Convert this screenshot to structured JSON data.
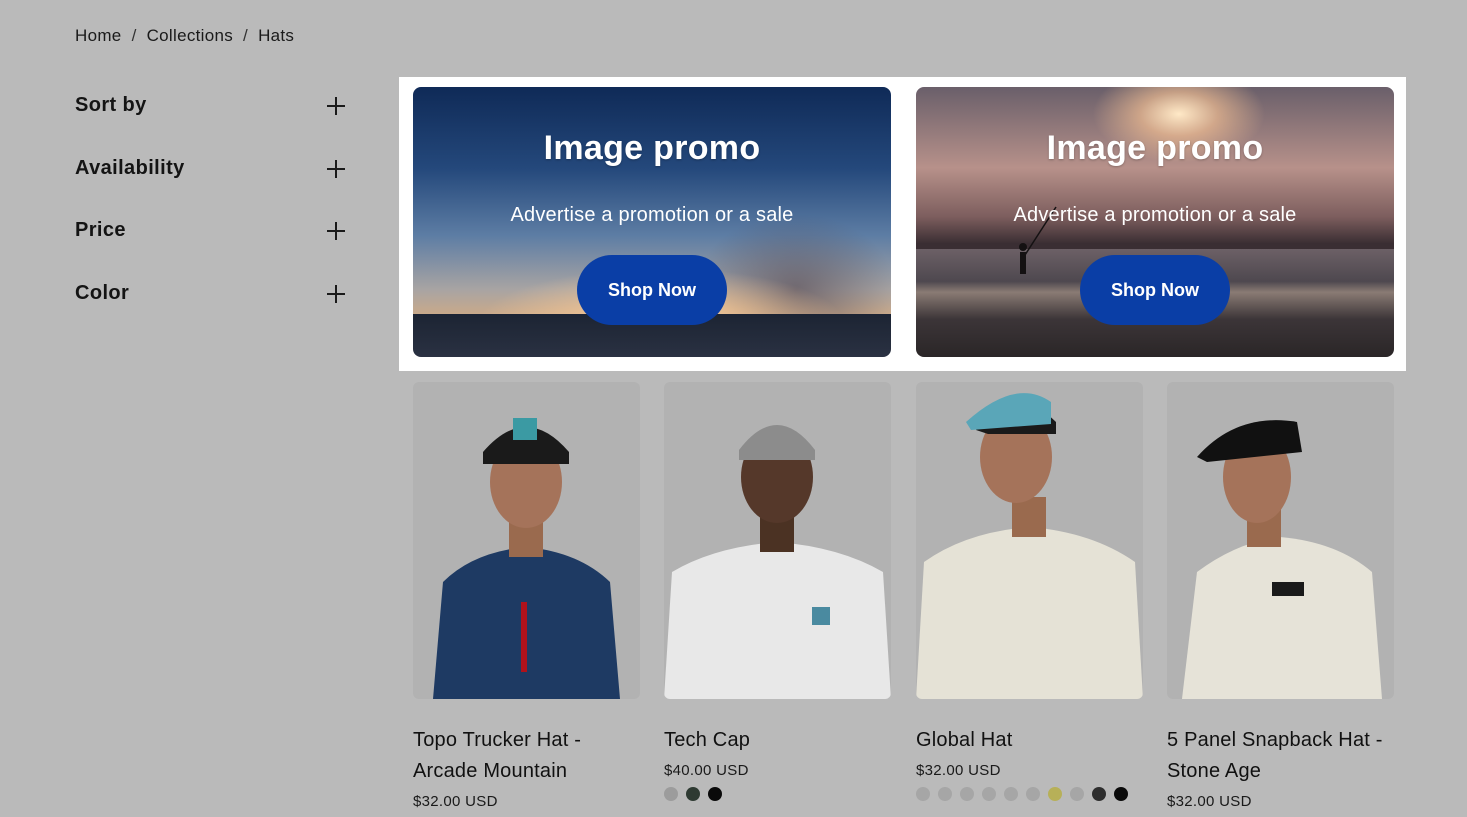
{
  "breadcrumb": {
    "home": "Home",
    "collections": "Collections",
    "current": "Hats",
    "separator": "/"
  },
  "filters": [
    {
      "label": "Sort by",
      "icon": "plus-icon"
    },
    {
      "label": "Availability",
      "icon": "plus-icon"
    },
    {
      "label": "Price",
      "icon": "plus-icon"
    },
    {
      "label": "Color",
      "icon": "plus-icon"
    }
  ],
  "promos": [
    {
      "title": "Image promo",
      "subtitle": "Advertise a promotion or a sale",
      "button": "Shop Now"
    },
    {
      "title": "Image promo",
      "subtitle": "Advertise a promotion or a sale",
      "button": "Shop Now"
    }
  ],
  "products": [
    {
      "title_line1": "Topo Trucker Hat -",
      "title_line2": "Arcade Mountain",
      "price": "$32.00 USD",
      "hat_color": "#1a1a1a",
      "shirt_color": "#1e3a63",
      "swatches": []
    },
    {
      "title_line1": "Tech Cap",
      "title_line2": "",
      "price": "$40.00 USD",
      "hat_color": "#8c8c8c",
      "shirt_color": "#e8e8e8",
      "swatches": [
        "#9c9c9c",
        "#2e3a32",
        "#0a0a0a"
      ]
    },
    {
      "title_line1": "Global Hat",
      "title_line2": "",
      "price": "$32.00 USD",
      "hat_color": "#5aa6b8",
      "shirt_color": "#e5e2d6",
      "swatches": [
        "#a6a6a6",
        "#a6a6a6",
        "#a6a6a6",
        "#a6a6a6",
        "#a6a6a6",
        "#a6a6a6",
        "#b7b058",
        "#a6a6a6",
        "#2e2e2e",
        "#0a0a0a"
      ]
    },
    {
      "title_line1": "5 Panel Snapback Hat -",
      "title_line2": "Stone Age",
      "price": "$32.00 USD",
      "hat_color": "#111111",
      "shirt_color": "#e6e3d8",
      "swatches": []
    }
  ],
  "colors": {
    "page_bg": "#bababa",
    "button": "#0a3ea6",
    "promo_frame": "#ffffff"
  }
}
